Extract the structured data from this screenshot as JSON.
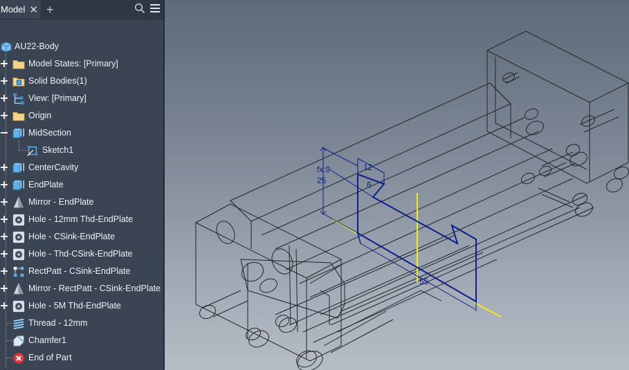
{
  "browser": {
    "tab_label": "Model",
    "tab_close": "✕",
    "add_tab": "+",
    "root": "AU22-Body",
    "items": [
      {
        "label": "Model States: [Primary]",
        "icon": "folder-icon",
        "expand": "+"
      },
      {
        "label": "Solid Bodies(1)",
        "icon": "solid-bodies-folder-icon",
        "expand": "+"
      },
      {
        "label": "View: [Primary]",
        "icon": "view-rep-icon",
        "expand": "+"
      },
      {
        "label": "Origin",
        "icon": "folder-icon",
        "expand": "+"
      },
      {
        "label": "MidSection",
        "icon": "extrude-icon",
        "expand": "−"
      },
      {
        "label": "Sketch1",
        "icon": "sketch-icon",
        "expand": ""
      },
      {
        "label": "CenterCavity",
        "icon": "extrude-icon",
        "expand": "+"
      },
      {
        "label": "EndPlate",
        "icon": "extrude-icon",
        "expand": "+"
      },
      {
        "label": "Mirror - EndPlate",
        "icon": "mirror-icon",
        "expand": "+"
      },
      {
        "label": "Hole - 12mm Thd-EndPlate",
        "icon": "hole-icon",
        "expand": "+"
      },
      {
        "label": "Hole - CSink-EndPlate",
        "icon": "hole-icon",
        "expand": "+"
      },
      {
        "label": "Hole - Thd-CSink-EndPlate",
        "icon": "hole-icon",
        "expand": "+"
      },
      {
        "label": "RectPatt - CSink-EndPlate",
        "icon": "rect-pattern-icon",
        "expand": "+"
      },
      {
        "label": "Mirror - RectPatt - CSink-EndPlate",
        "icon": "mirror-icon",
        "expand": "+"
      },
      {
        "label": "Hole - 5M Thd-EndPlate",
        "icon": "hole-icon",
        "expand": "+"
      },
      {
        "label": "Thread - 12mm",
        "icon": "thread-icon",
        "expand": ""
      },
      {
        "label": "Chamfer1",
        "icon": "chamfer-icon",
        "expand": ""
      },
      {
        "label": "End of Part",
        "icon": "end-of-part-icon",
        "expand": ""
      }
    ]
  },
  "sketch_dims": {
    "d1": "12",
    "d2": "fx:9",
    "d3": "25",
    "d4": "6",
    "d5": "55"
  },
  "colors": {
    "sketch_line": "#0b1f8c",
    "axis_yellow": "#f2ee1c",
    "wireframe": "#20242a"
  }
}
